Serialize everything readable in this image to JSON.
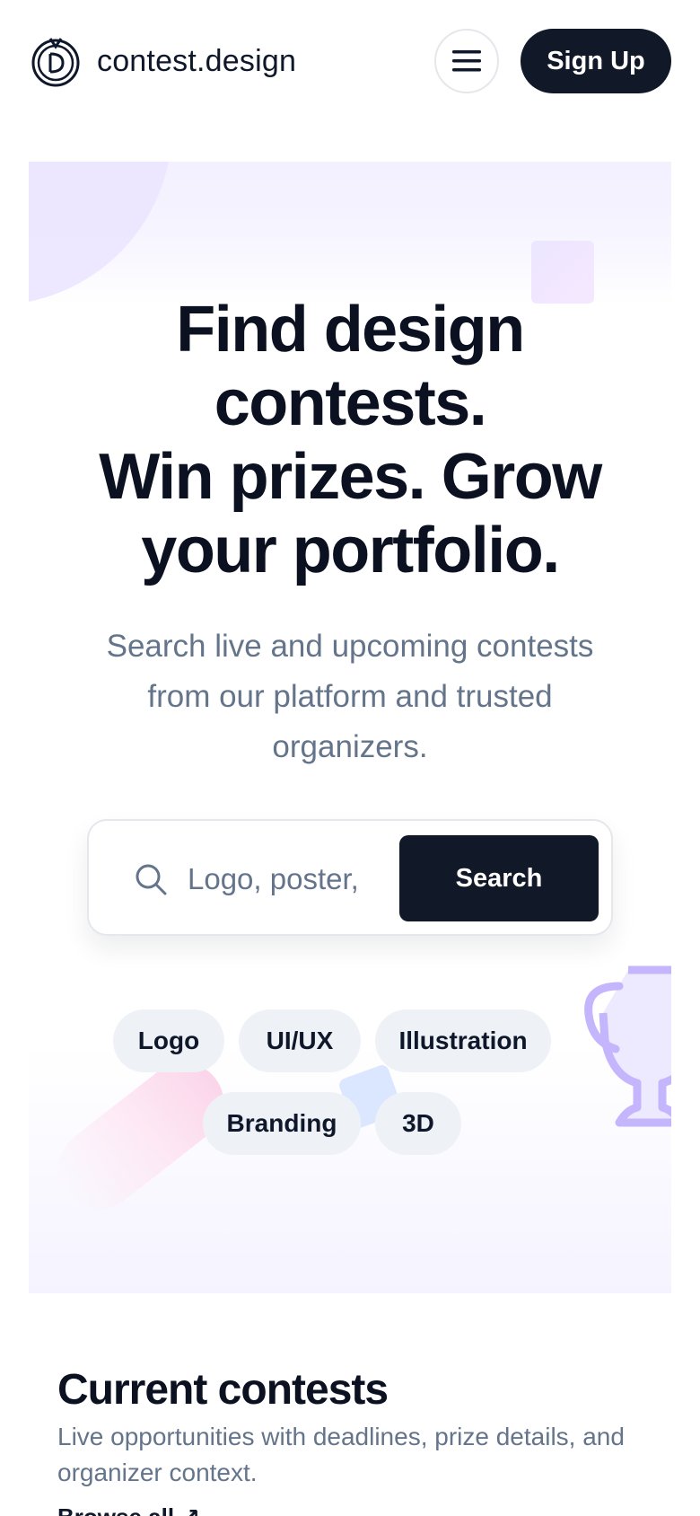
{
  "header": {
    "brand": "contest.design",
    "menu_icon": "hamburger-menu-icon",
    "signup_label": "Sign Up"
  },
  "hero": {
    "title_line1": "Find design",
    "title_line2": "contests.",
    "title_line3": "Win prizes. Grow",
    "title_line4": "your portfolio.",
    "subtitle": "Search live and upcoming contests from our platform and trusted organizers."
  },
  "search": {
    "placeholder": "Logo, poster, UI...",
    "button_label": "Search",
    "icon": "search-icon"
  },
  "chips": [
    "Logo",
    "UI/UX",
    "Illustration",
    "Branding",
    "3D"
  ],
  "contests": {
    "title": "Current contests",
    "subtitle": "Live opportunities with deadlines, prize details, and organizer context.",
    "link_label": "Browse all ↗"
  },
  "colors": {
    "primary_dark": "#111827",
    "muted_text": "#64748b",
    "chip_bg": "#eef2f7",
    "hero_tint": "#f4f2ff",
    "accent_purple": "#c4b5fd"
  }
}
